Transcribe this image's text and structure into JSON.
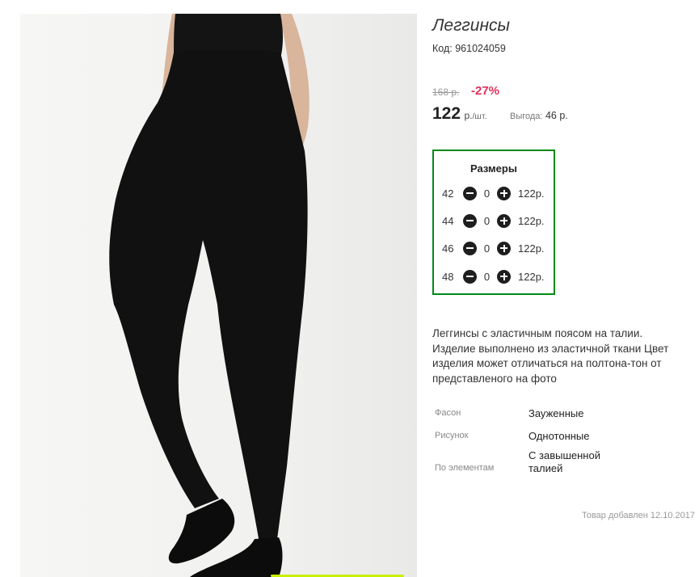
{
  "product": {
    "title": "Леггинсы",
    "code_label": "Код:",
    "code": "961024059",
    "old_price": "168 р.",
    "discount": "-27%",
    "price": "122",
    "price_unit": "р.",
    "price_per": "/шт.",
    "benefit_label": "Выгода:",
    "benefit_value": "46 р."
  },
  "sizes": {
    "title": "Размеры",
    "rows": [
      {
        "size": "42",
        "qty": "0",
        "price": "122р."
      },
      {
        "size": "44",
        "qty": "0",
        "price": "122р."
      },
      {
        "size": "46",
        "qty": "0",
        "price": "122р."
      },
      {
        "size": "48",
        "qty": "0",
        "price": "122р."
      }
    ],
    "minus_icon": "minus-circle-icon",
    "plus_icon": "plus-circle-icon"
  },
  "description": "Леггинсы с эластичным поясом на талии. Изделие выполнено из эластичной ткани Цвет изделия может отличаться на полтона-тон от представленого на фото",
  "attributes": [
    {
      "label": "Фасон",
      "value": "Зауженные"
    },
    {
      "label": "Рисунок",
      "value": "Однотонные"
    },
    {
      "label": "По элементам",
      "value": "С завышенной талией"
    }
  ],
  "added_text": "Товар добавлен 12.10.2017",
  "colors": {
    "discount": "#e0315a",
    "sizes_border": "#008a18",
    "accent_strip": "#c6f000"
  }
}
